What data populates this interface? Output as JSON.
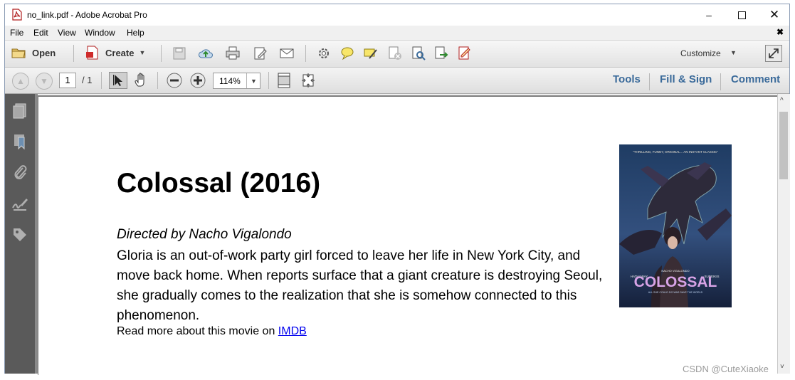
{
  "window": {
    "title": "no_link.pdf - Adobe Acrobat Pro"
  },
  "menu": {
    "items": [
      "File",
      "Edit",
      "View",
      "Window",
      "Help"
    ]
  },
  "toolbar": {
    "open_label": "Open",
    "create_label": "Create",
    "customize_label": "Customize"
  },
  "nav": {
    "page_current": "1",
    "page_total": "/ 1",
    "zoom": "114%"
  },
  "right_tabs": {
    "tools": "Tools",
    "fill_sign": "Fill & Sign",
    "comment": "Comment"
  },
  "document": {
    "title": "Colossal (2016)",
    "director": "Directed by Nacho Vigalondo",
    "description_lines": [
      "Gloria is an out-of-work party girl forced to leave her life in New York City, and",
      "move back home. When reports surface that a giant creature is destroying Seoul,",
      "she gradually comes to the realization that she is somehow connected to this",
      "phenomenon."
    ],
    "read_more_prefix": "Read more about this movie on ",
    "read_more_link": "IMDB",
    "poster": {
      "tagline": "\"THRILLING, FUNNY, ORIGINAL... AN INSTANT CLASSIC\"",
      "title": "COLOSSAL",
      "left_name": "HATHAWAY",
      "center_name": "NACHO VIGALONDO",
      "right_name": "SUDEIKIS",
      "bottom_text": "ALL SHE COULD DO WAS SAVE THE WORLD"
    }
  },
  "watermark": "CSDN @CuteXiaoke",
  "colors": {
    "accent": "#3a6a9a",
    "panel": "#5a5a5a",
    "link": "#0000ee"
  }
}
